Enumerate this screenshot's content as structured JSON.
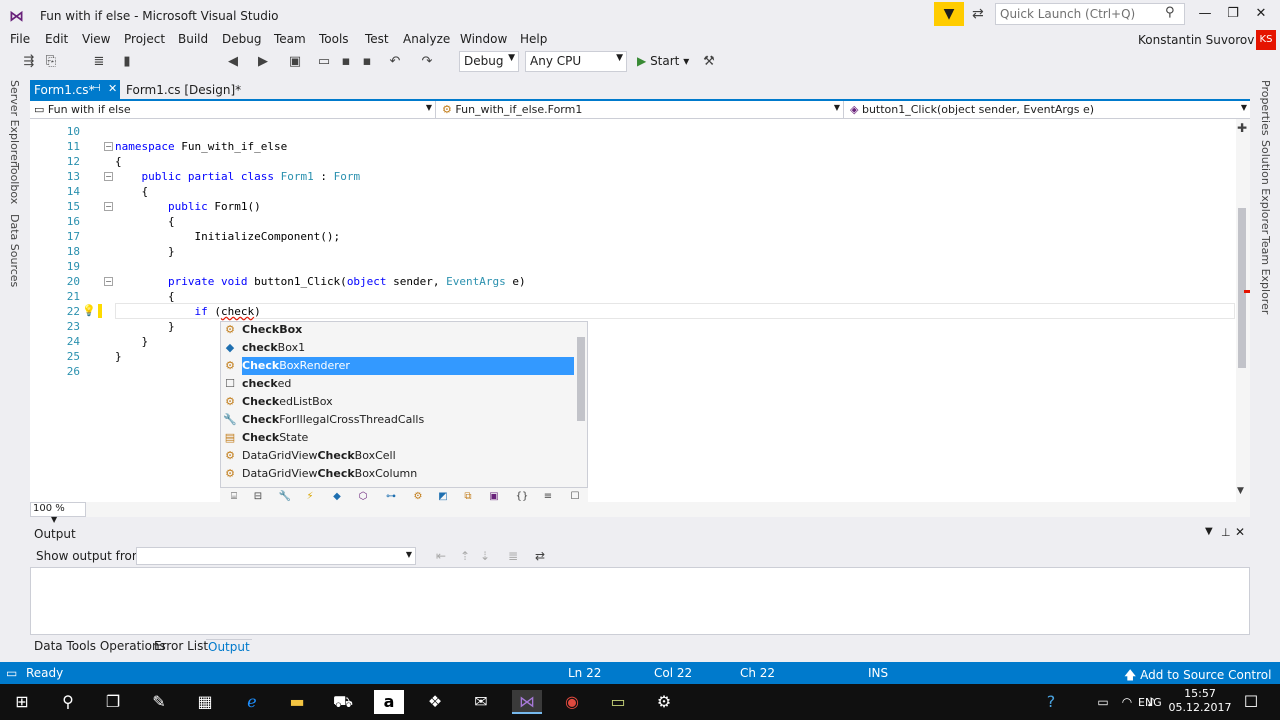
{
  "window": {
    "title": "Fun with if else - Microsoft Visual Studio",
    "quick_launch_placeholder": "Quick Launch (Ctrl+Q)",
    "user_name": "Konstantin Suvorov",
    "user_initials": "KS"
  },
  "menu": [
    "File",
    "Edit",
    "View",
    "Project",
    "Build",
    "Debug",
    "Team",
    "Tools",
    "Test",
    "Analyze",
    "Window",
    "Help"
  ],
  "toolbar": {
    "config": "Debug",
    "platform": "Any CPU",
    "start_label": "Start"
  },
  "side_tabs_left": [
    "Server Explorer",
    "Toolbox",
    "Data Sources"
  ],
  "side_tabs_right": [
    "Properties",
    "Solution Explorer",
    "Team Explorer"
  ],
  "doc_tabs": {
    "active": "Form1.cs*",
    "inactive": "Form1.cs [Design]*"
  },
  "nav": {
    "project": "Fun with if else",
    "class": "Fun_with_if_else.Form1",
    "member": "button1_Click(object sender, EventArgs e)"
  },
  "code_lines": [
    {
      "n": "10",
      "t": ""
    },
    {
      "n": "11",
      "t": "namespace Fun_with_if_else"
    },
    {
      "n": "12",
      "t": "{"
    },
    {
      "n": "13",
      "t": "    public partial class Form1 : Form"
    },
    {
      "n": "14",
      "t": "    {"
    },
    {
      "n": "15",
      "t": "        public Form1()"
    },
    {
      "n": "16",
      "t": "        {"
    },
    {
      "n": "17",
      "t": "            InitializeComponent();"
    },
    {
      "n": "18",
      "t": "        }"
    },
    {
      "n": "19",
      "t": ""
    },
    {
      "n": "20",
      "t": "        private void button1_Click(object sender, EventArgs e)"
    },
    {
      "n": "21",
      "t": "        {"
    },
    {
      "n": "22",
      "t": "            if (check)"
    },
    {
      "n": "23",
      "t": "        }"
    },
    {
      "n": "24",
      "t": "    }"
    },
    {
      "n": "25",
      "t": "}"
    },
    {
      "n": "26",
      "t": ""
    }
  ],
  "intellisense": {
    "items": [
      {
        "label": "CheckBox",
        "icon": "class-icon"
      },
      {
        "label": "checkBox1",
        "icon": "field-icon"
      },
      {
        "label": "CheckBoxRenderer",
        "icon": "class-icon",
        "selected": true
      },
      {
        "label": "checked",
        "icon": "keyword-icon"
      },
      {
        "label": "CheckedListBox",
        "icon": "class-icon"
      },
      {
        "label": "CheckForIllegalCrossThreadCalls",
        "icon": "property-icon"
      },
      {
        "label": "CheckState",
        "icon": "enum-icon"
      },
      {
        "label": "DataGridViewCheckBoxCell",
        "icon": "class-icon"
      },
      {
        "label": "DataGridViewCheckBoxColumn",
        "icon": "class-icon"
      }
    ]
  },
  "zoom": "100 %",
  "output": {
    "title": "Output",
    "show_from_label": "Show output from:",
    "show_from_value": ""
  },
  "bottom_tabs": [
    "Data Tools Operations",
    "Error List",
    "Output"
  ],
  "status": {
    "ready": "Ready",
    "ln": "Ln 22",
    "col": "Col 22",
    "ch": "Ch 22",
    "mode": "INS",
    "source_control": "Add to Source Control"
  },
  "taskbar": {
    "lang": "ENG",
    "time": "15:57",
    "date": "05.12.2017"
  }
}
